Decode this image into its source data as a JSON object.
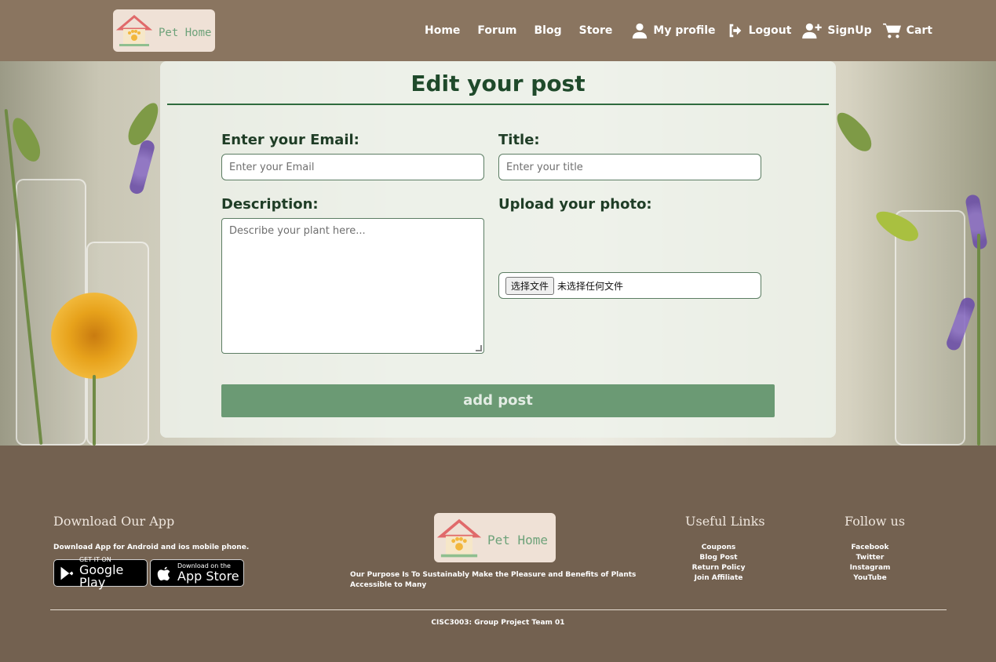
{
  "header": {
    "logo_text": "Pet Home",
    "nav": [
      {
        "label": "Home"
      },
      {
        "label": "Forum"
      },
      {
        "label": "Blog"
      },
      {
        "label": "Store"
      }
    ],
    "icon_nav": [
      {
        "label": "My profile",
        "icon": "user-icon"
      },
      {
        "label": "Logout",
        "icon": "logout-icon"
      },
      {
        "label": "SignUp",
        "icon": "user-plus-icon"
      },
      {
        "label": "Cart",
        "icon": "cart-icon"
      }
    ]
  },
  "form": {
    "title": "Edit your post",
    "email_label": "Enter your Email:",
    "email_placeholder": "Enter your Email",
    "title_label": "Title:",
    "title_placeholder": "Enter your title",
    "description_label": "Description:",
    "description_placeholder": "Describe your plant here...",
    "photo_label": "Upload your photo:",
    "file_button": "选择文件",
    "file_status": "未选择任何文件",
    "submit_label": "add post"
  },
  "footer": {
    "download_heading": "Download Our App",
    "download_text": "Download App for Android and ios mobile phone.",
    "google_play_small": "GET IT ON",
    "google_play_big": "Google Play",
    "app_store_small": "Download on the",
    "app_store_big": "App Store",
    "logo_text": "Pet Home",
    "purpose": "Our Purpose Is To Sustainably Make the Pleasure and Benefits of Plants Accessible to Many",
    "useful_heading": "Useful Links",
    "useful_links": [
      "Coupons",
      "Blog Post",
      "Return Policy",
      "Join Affiliate"
    ],
    "follow_heading": "Follow us",
    "follow_links": [
      "Facebook",
      "Twitter",
      "Instagram",
      "YouTube"
    ],
    "copyright": "CISC3003: Group Project Team 01"
  },
  "colors": {
    "header_bg": "#8a7560",
    "footer_bg": "#736150",
    "accent_green": "#2f6b3e",
    "button_green": "#6b9a74"
  }
}
